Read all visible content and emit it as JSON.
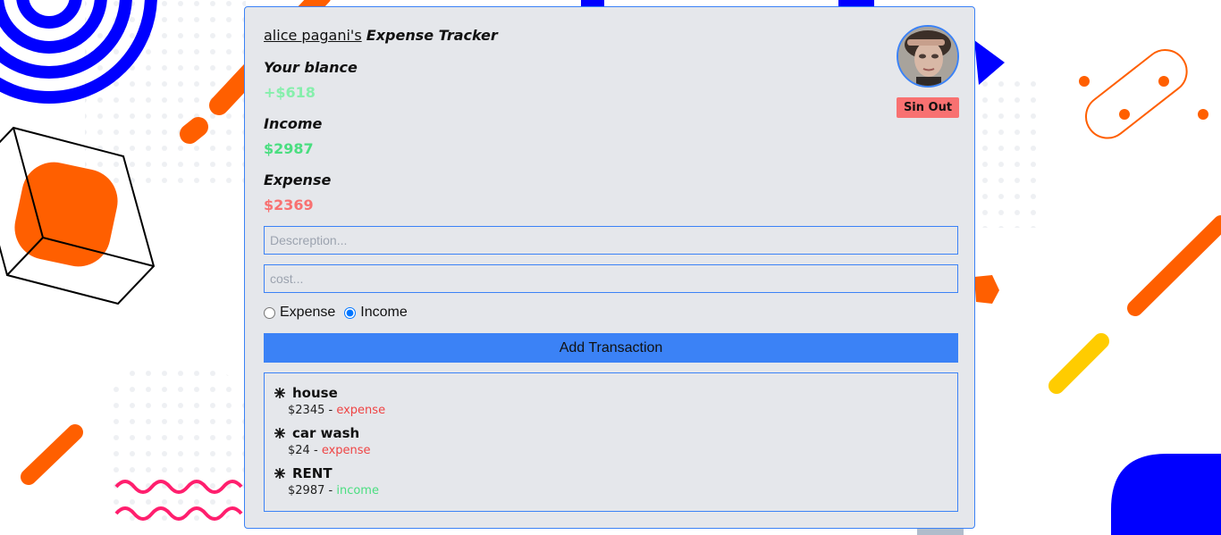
{
  "header": {
    "user_name": "alice pagani's",
    "app_title": "Expense Tracker"
  },
  "account": {
    "sign_out_label": "Sin Out"
  },
  "summary": {
    "balance_label": "Your blance",
    "balance_value": "+$618",
    "income_label": "Income",
    "income_value": "$2987",
    "expense_label": "Expense",
    "expense_value": "$2369"
  },
  "form": {
    "description_placeholder": "Descreption...",
    "cost_placeholder": "cost...",
    "radio_expense_label": "Expense",
    "radio_income_label": "Income",
    "selected_type": "Income",
    "add_button_label": "Add Transaction"
  },
  "transactions": [
    {
      "name": "house",
      "amount": "$2345",
      "separator": "-",
      "type": "expense"
    },
    {
      "name": "car wash",
      "amount": "$24",
      "separator": "-",
      "type": "expense"
    },
    {
      "name": "RENT",
      "amount": "$2987",
      "separator": "-",
      "type": "income"
    }
  ],
  "colors": {
    "accent": "#3b82f6",
    "card_bg": "#e5e7eb",
    "income": "#4ade80",
    "expense": "#f87171",
    "signout": "#f87171",
    "decor_orange": "#ff5f00",
    "decor_blue": "#0000ff",
    "decor_yellow": "#ffcc00",
    "decor_pink": "#ff1f6e"
  },
  "icons": {
    "transaction_marker": "asterisk-icon",
    "avatar": "user-avatar-photo"
  }
}
